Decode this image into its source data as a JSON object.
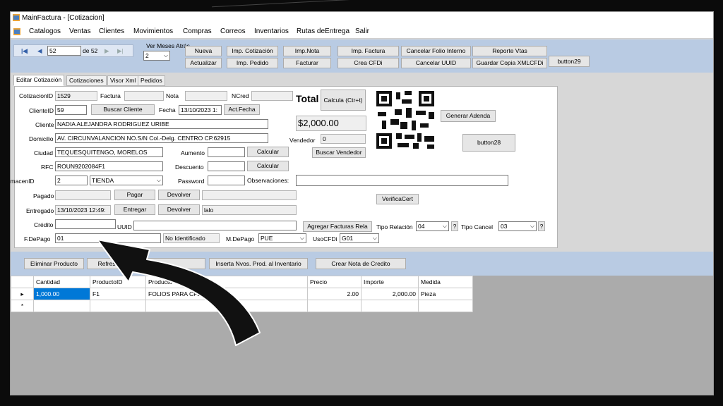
{
  "window": {
    "title": "MainFactura - [Cotizacion]"
  },
  "menu": [
    "Catalogos",
    "Ventas",
    "Clientes",
    "Movimientos",
    "Compras",
    "Correos",
    "Inventarios",
    "Rutas deEntrega",
    "Salir"
  ],
  "navigator": {
    "current": "52",
    "of_label": "de 52"
  },
  "toolbar": {
    "meses_label": "Ver Meses Atrás",
    "meses_value": "2",
    "buttons": {
      "nueva": "Nueva",
      "imp_cotizacion": "Imp. Cotización",
      "imp_nota": "Imp.Nota",
      "imp_factura": "Imp. Factura",
      "cancelar_folio": "Cancelar Folio Interno",
      "reporte_vtas": "Reporte Vtas",
      "button29": "button29",
      "actualizar": "Actualizar",
      "imp_pedido": "Imp. Pedido",
      "facturar": "Facturar",
      "crea_cfdi": "Crea CFDi",
      "cancelar_uuid": "Cancelar UUID",
      "guardar_copia": "Guardar Copia XMLCFDi"
    }
  },
  "tabs": [
    "Editar Cotización",
    "Cotizaciones",
    "Visor Xml",
    "Pedidos"
  ],
  "form": {
    "labels": {
      "cotizacion_id": "CotizacionID",
      "factura": "Factura",
      "nota": "Nota",
      "ncred": "NCred",
      "total": "Total",
      "cliente_id": "ClienteID",
      "fecha": "Fecha",
      "cliente": "Cliente",
      "domicilio": "Domicilio",
      "vendedor": "Vendedor",
      "ciudad": "Ciudad",
      "aumento": "Aumento",
      "rfc": "RFC",
      "descuento": "Descuento",
      "almacen_id": "AlmacenID",
      "password": "Password",
      "observaciones": "Observaciones:",
      "pagado": "Pagado",
      "entregado": "Entregado",
      "credito": "Crédito",
      "uuid": "UUID",
      "fdepago": "F.DePago",
      "mdepago": "M.DePago",
      "usocfdi": "UsoCFDi",
      "tipo_relacion": "Tipo Relación",
      "tipo_cancel": "Tipo Cancel"
    },
    "values": {
      "cotizacion_id": "1529",
      "cliente_id": "59",
      "fecha": "13/10/2023 1:",
      "cliente": "NADIA ALEJANDRA RODRIGUEZ URIBE",
      "domicilio": "AV. CIRCUNVALANCION NO.S/N Col.-Delg. CENTRO CP.62915",
      "ciudad": "TEQUESQUITENGO, MORELOS",
      "rfc": "ROUN9202084F1",
      "almacen_id": "2",
      "almacen_name": "TIENDA",
      "entregado": "13/10/2023 12:49:",
      "entregado_por": "lalo",
      "fdepago": "01",
      "fdepago_desc": "No Identificado",
      "mdepago": "PUE",
      "usocfdi": "G01",
      "total": "$2,000.00",
      "vendedor": "0",
      "tipo_relacion": "04",
      "tipo_cancel": "03"
    },
    "buttons": {
      "buscar_cliente": "Buscar Cliente",
      "act_fecha": "Act.Fecha",
      "calcula": "Calcula (Ctr+t)",
      "generar_adenda": "Generar Adenda",
      "button28": "button28",
      "buscar_vendedor": "Buscar Vendedor",
      "calcular": "Calcular",
      "pagar": "Pagar",
      "devolver": "Devolver",
      "entregar": "Entregar",
      "verifica_cert": "VerificaCert",
      "agregar_facturas": "Agregar Facturas Rela",
      "help": "?"
    }
  },
  "bottom_toolbar": {
    "eliminar": "Eliminar Producto",
    "refrescar": "Refrescar",
    "inserta": "Inserta Nvos. Prod. al Inventario",
    "crear_nota": "Crear Nota de Credito"
  },
  "grid": {
    "columns": [
      "Cantidad",
      "ProductoID",
      "Producto",
      "Precio",
      "Importe",
      "Medida"
    ],
    "rows": [
      {
        "marker": "▸",
        "cantidad": "1,000.00",
        "producto_id": "F1",
        "producto": "FOLIOS PARA CFDI",
        "precio": "2.00",
        "importe": "2,000.00",
        "medida": "Pieza"
      }
    ],
    "new_row_marker": "*"
  },
  "colors": {
    "toolbar_bg": "#b9cbe3",
    "grid_bg": "#ababab",
    "selection": "#0078d7",
    "arrow": "#111111"
  },
  "icons": [
    "app-icon",
    "first-record-icon",
    "prev-record-icon",
    "next-record-icon",
    "last-record-icon",
    "qr-code-icon",
    "pointer-arrow-icon",
    "dropdown-arrow-icon"
  ]
}
